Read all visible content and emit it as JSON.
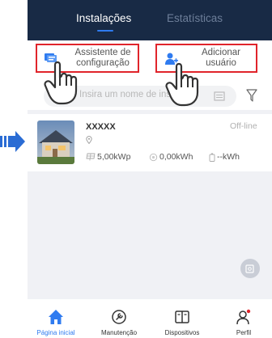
{
  "tabs": [
    {
      "label": "Instalações",
      "active": true
    },
    {
      "label": "Estatísticas",
      "active": false
    }
  ],
  "actions": {
    "setup_wizard": "Assistente de configuração",
    "add_user": "Adicionar usuário"
  },
  "search": {
    "placeholder": "Insira um nome de ins"
  },
  "plant": {
    "name": "XXXXX",
    "status": "Off-line",
    "capacity": "5,00kWp",
    "energy": "0,00kWh",
    "yield": "--kWh"
  },
  "nav": [
    {
      "label": "Página inicial",
      "icon": "home-icon",
      "active": true
    },
    {
      "label": "Manutenção",
      "icon": "maintenance-icon",
      "active": false
    },
    {
      "label": "Dispositivos",
      "icon": "devices-icon",
      "active": false
    },
    {
      "label": "Perfil",
      "icon": "profile-icon",
      "active": false
    }
  ],
  "colors": {
    "header_bg": "#182a45",
    "accent_blue": "#2f7bf0",
    "highlight_red": "#e0242b",
    "arrow_blue": "#2a6cd4"
  }
}
